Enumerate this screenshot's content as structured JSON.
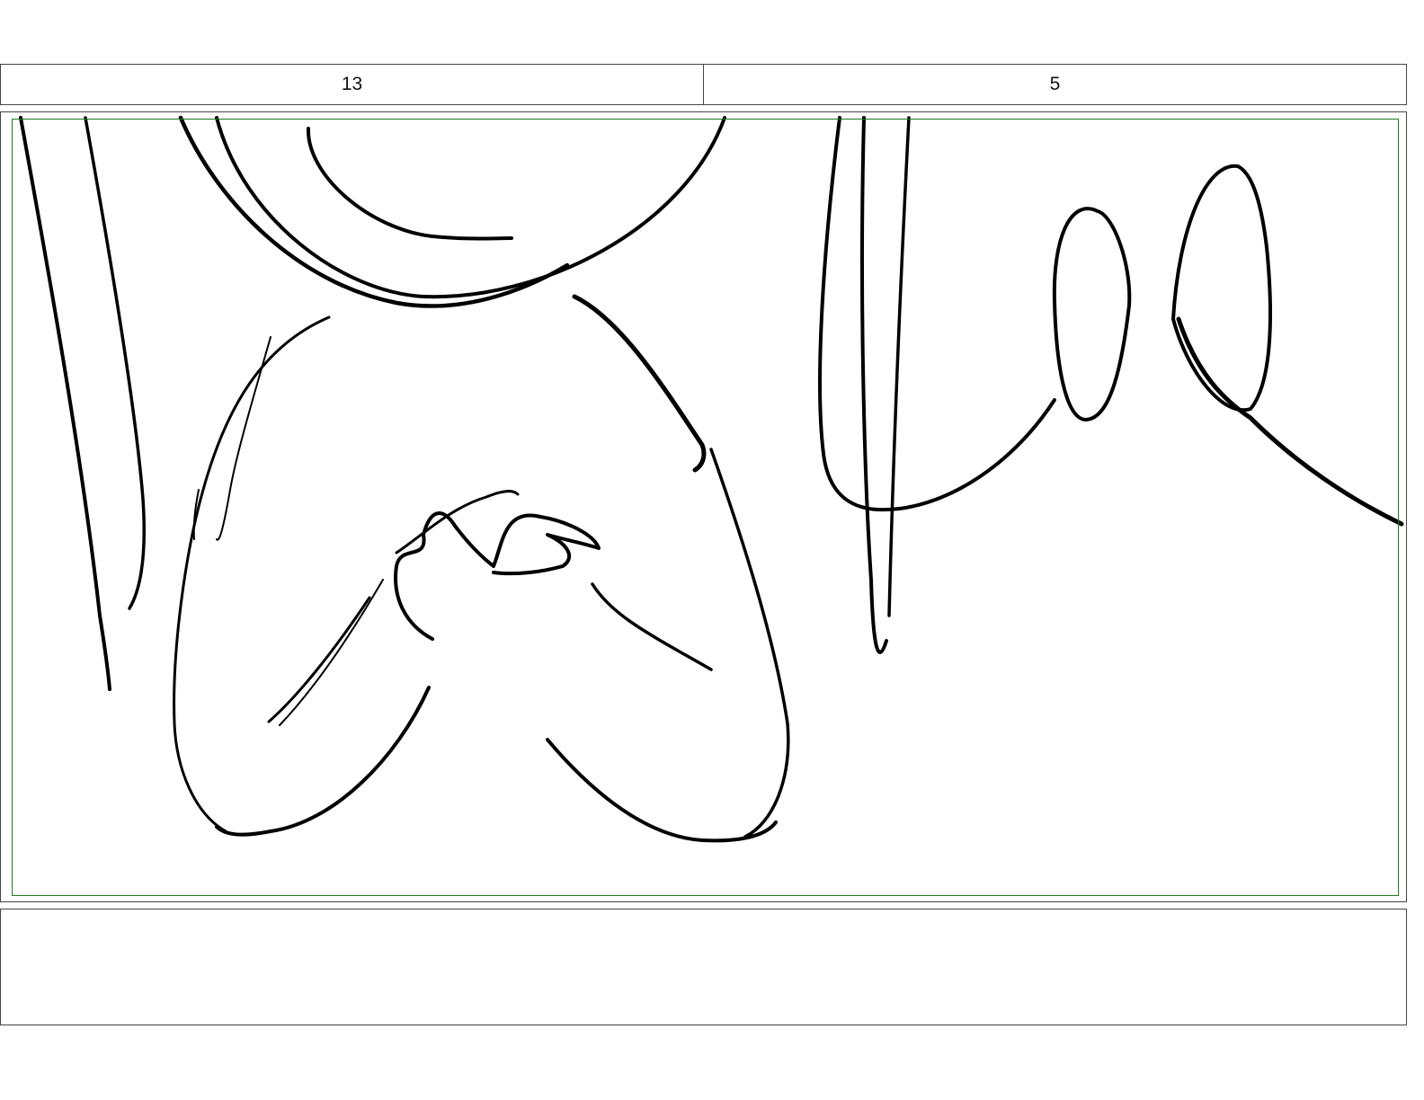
{
  "header": {
    "scene_number": "13",
    "panel_number": "5"
  },
  "panel": {
    "safe_area_color": "#1f7a1f",
    "line_color": "#000000"
  },
  "notes": {
    "text": ""
  }
}
